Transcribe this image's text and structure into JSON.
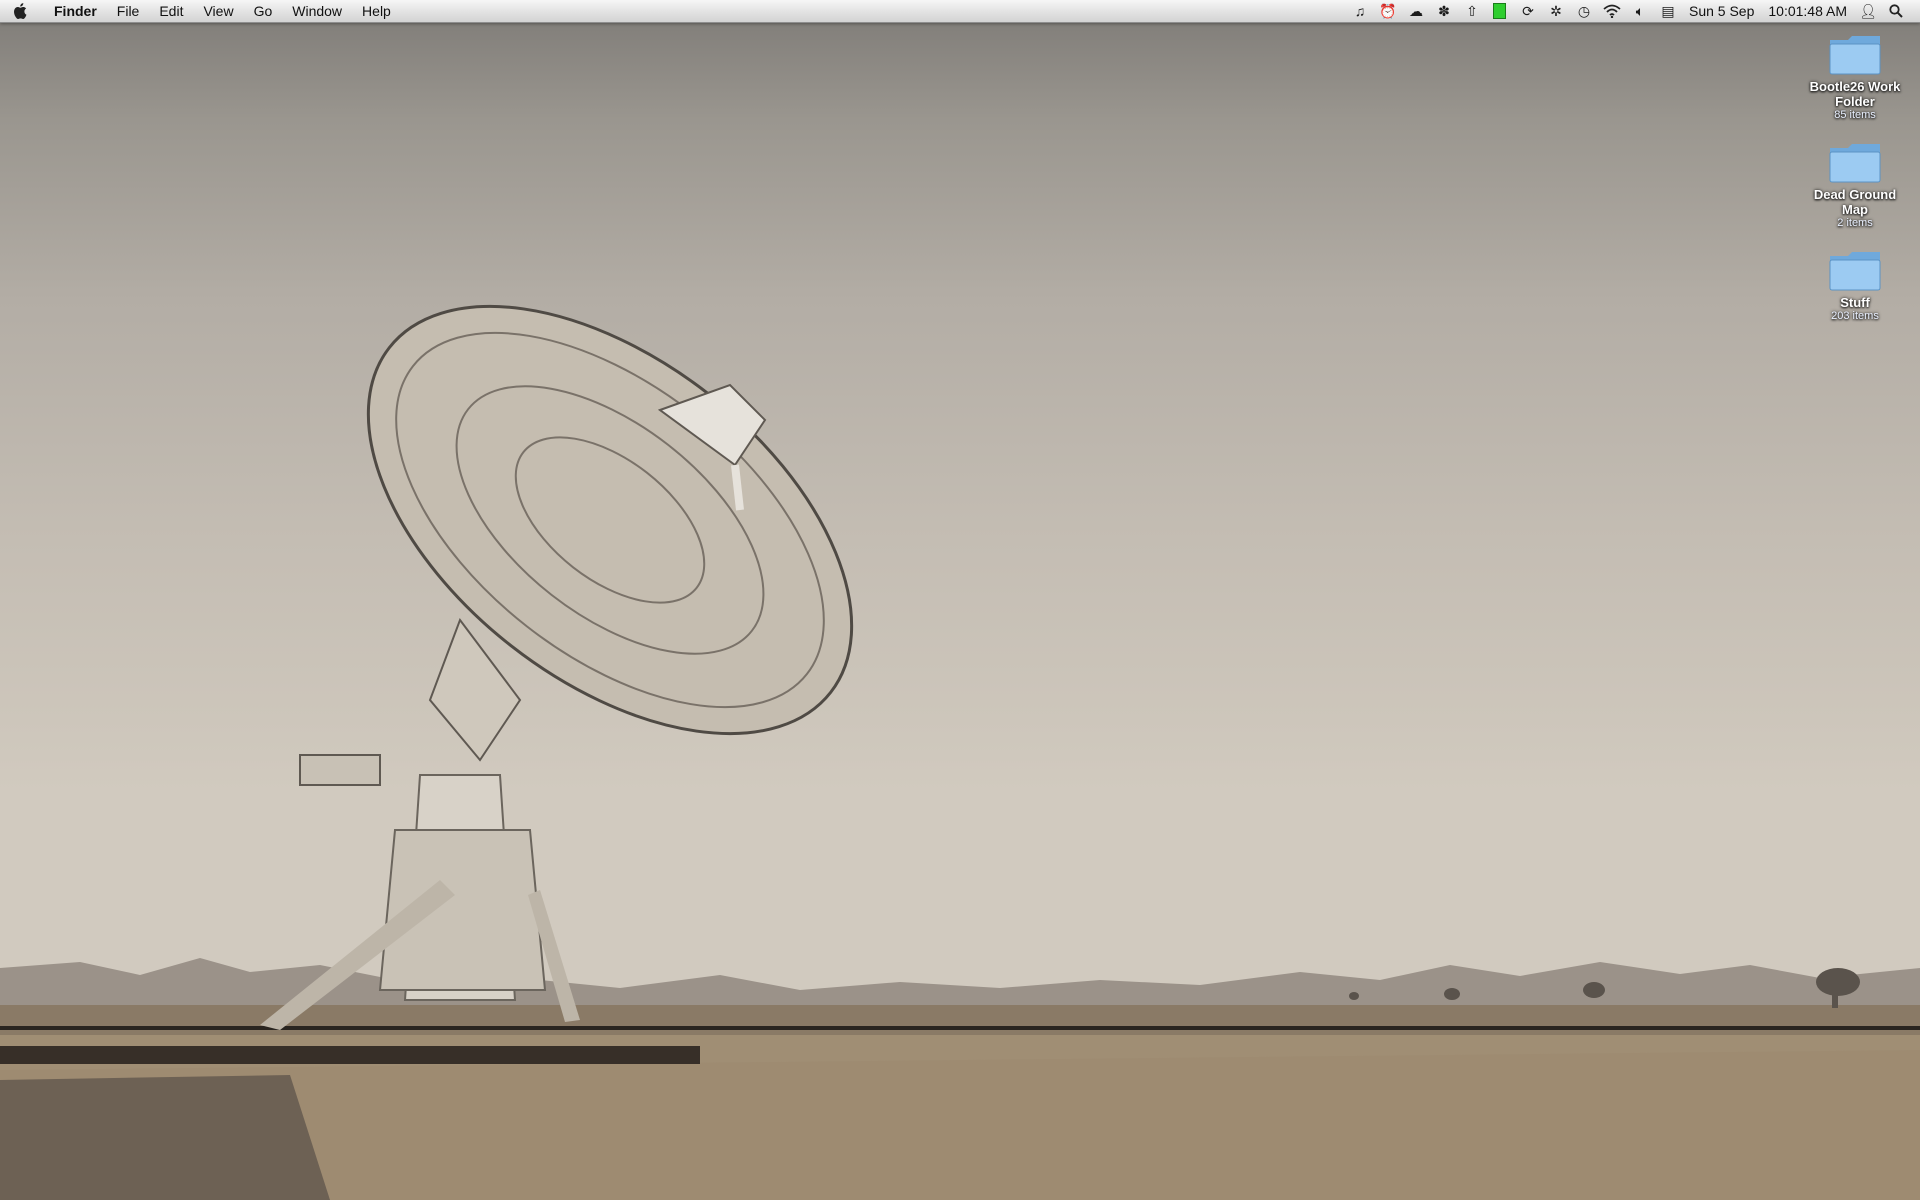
{
  "menubar": {
    "app_name": "Finder",
    "menus": [
      "File",
      "Edit",
      "View",
      "Go",
      "Window",
      "Help"
    ],
    "status_icons": [
      "itunes-note-icon",
      "alarm-clock-icon",
      "cloud-sync-icon",
      "paw-icon",
      "upload-icon",
      "battery-green-icon",
      "sync-icon",
      "bluetooth-icon",
      "time-machine-icon",
      "wifi-icon",
      "volume-icon",
      "keyboard-input-icon"
    ],
    "date": "Sun 5 Sep",
    "time": "10:01:48 AM"
  },
  "desktop_icons": [
    {
      "name": "Bootle26 Work Folder",
      "info": "85 items"
    },
    {
      "name": "Dead Ground Map",
      "info": "2 items"
    },
    {
      "name": "Stuff",
      "info": "203 items"
    }
  ],
  "colors": {
    "folder_blue": "#8fc3ee",
    "menubar": "#e6e6e6"
  }
}
